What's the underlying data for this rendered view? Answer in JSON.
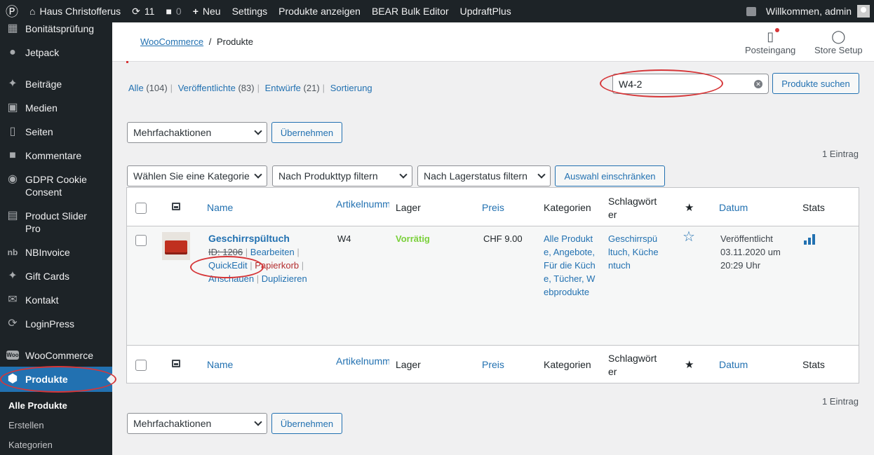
{
  "adminbar": {
    "site_name": "Haus Christofferus",
    "updates_count": "11",
    "comments_count": "0",
    "new_label": "Neu",
    "items": [
      "Settings",
      "Produkte anzeigen",
      "BEAR Bulk Editor",
      "UpdraftPlus"
    ],
    "welcome": "Willkommen, admin"
  },
  "sidebar": {
    "items": [
      {
        "label": "Bonitätsprüfung",
        "icon": "grid-icon"
      },
      {
        "label": "Jetpack",
        "icon": "jetpack-icon"
      },
      {
        "label": "Beiträge",
        "icon": "pin-icon"
      },
      {
        "label": "Medien",
        "icon": "media-icon"
      },
      {
        "label": "Seiten",
        "icon": "pages-icon"
      },
      {
        "label": "Kommentare",
        "icon": "comment-icon"
      },
      {
        "label": "GDPR Cookie Consent",
        "icon": "cookie-icon"
      },
      {
        "label": "Product Slider Pro",
        "icon": "cart-icon"
      },
      {
        "label": "NBInvoice",
        "icon": "nb-icon"
      },
      {
        "label": "Gift Cards",
        "icon": "pin-icon"
      },
      {
        "label": "Kontakt",
        "icon": "mail-icon"
      },
      {
        "label": "LoginPress",
        "icon": "loginpress-icon"
      },
      {
        "label": "WooCommerce",
        "icon": "woo-icon"
      },
      {
        "label": "Produkte",
        "icon": "box-icon"
      }
    ],
    "subitems": [
      "Alle Produkte",
      "Erstellen",
      "Kategorien"
    ]
  },
  "header": {
    "breadcrumb_link": "WooCommerce",
    "breadcrumb_sep": "/",
    "breadcrumb_current": "Produkte",
    "inbox_label": "Posteingang",
    "setup_label": "Store Setup"
  },
  "views": [
    {
      "label": "Alle",
      "count": "(104)"
    },
    {
      "label": "Veröffentlichte",
      "count": "(83)"
    },
    {
      "label": "Entwürfe",
      "count": "(21)"
    },
    {
      "label": "Sortierung",
      "count": ""
    }
  ],
  "search": {
    "value": "W4-2",
    "button": "Produkte suchen"
  },
  "bulk": {
    "select": "Mehrfachaktionen",
    "apply": "Übernehmen"
  },
  "filters": {
    "category": "Wählen Sie eine Kategorie",
    "type": "Nach Produkttyp filtern",
    "stock": "Nach Lagerstatus filtern",
    "apply": "Auswahl einschränken"
  },
  "count_text": "1 Eintrag",
  "table": {
    "headers": {
      "name": "Name",
      "sku": "Artikelnummer",
      "stock": "Lager",
      "price": "Preis",
      "categories": "Kategorien",
      "tags": "Schlagwörter",
      "date": "Datum",
      "stats": "Stats"
    },
    "row": {
      "name": "Geschirrspültuch",
      "id": "ID: 1206",
      "edit": "Bearbeiten",
      "quickedit": "QuickEdit",
      "trash": "Papierkorb",
      "view": "Anschauen",
      "duplicate": "Duplizieren",
      "sku": "W4",
      "stock": "Vorrätig",
      "price": "CHF 9.00",
      "categories": "Alle Produkte, Angebote, Für die Küche, Tücher, Webprodukte",
      "tags": "Geschirrspültuch, Küchentuch",
      "date_status": "Veröffentlicht",
      "date_value": "03.11.2020 um 20:29 Uhr"
    }
  },
  "accent_color": "#2271b1",
  "highlight_color": "#d63638"
}
